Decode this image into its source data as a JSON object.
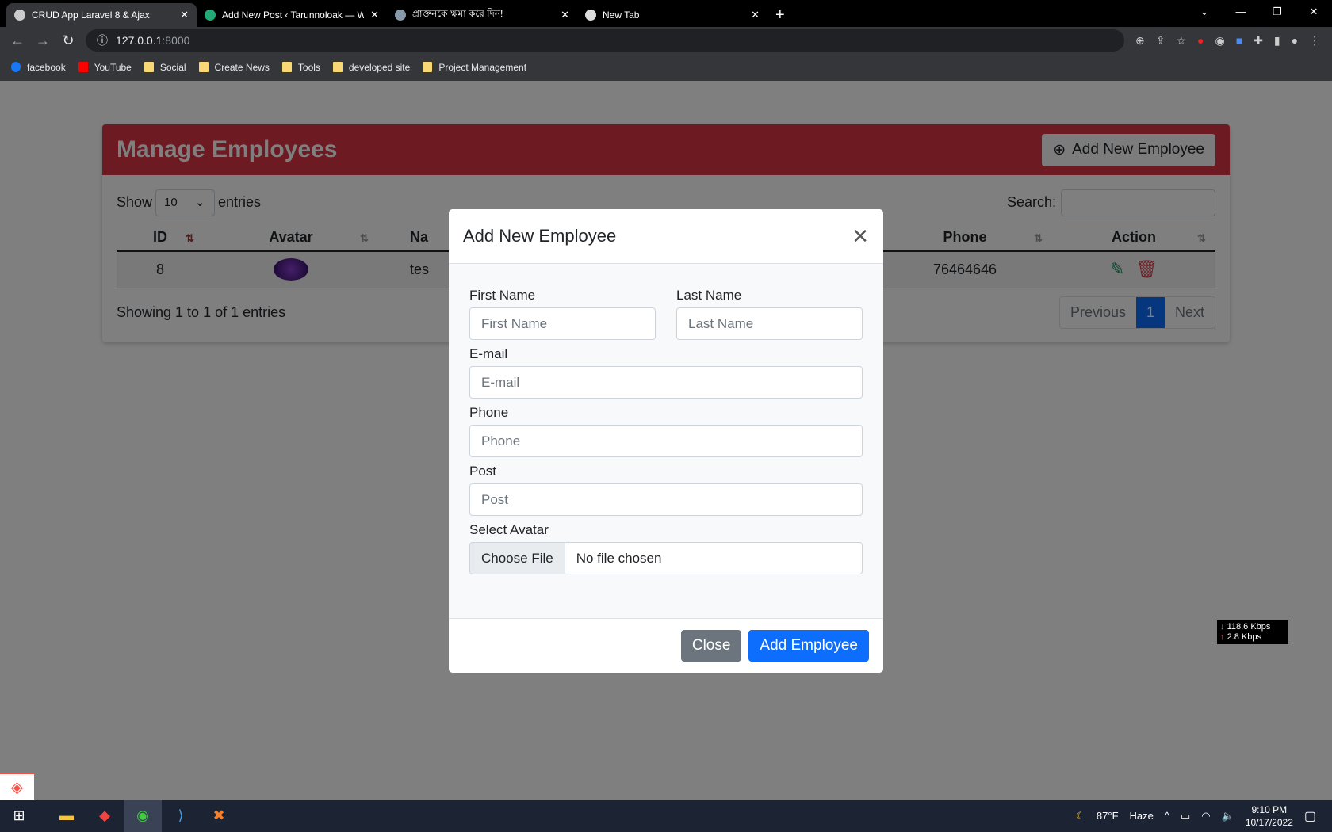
{
  "browser": {
    "tabs": [
      {
        "title": "CRUD App Laravel 8 & Ajax",
        "active": true
      },
      {
        "title": "Add New Post ‹ Tarunnoloak — W"
      },
      {
        "title": "প্রাক্তনকে ক্ষমা করে দিন!"
      },
      {
        "title": "New Tab"
      }
    ],
    "url_host": "127.0.0.1",
    "url_port": ":8000",
    "bookmarks": [
      "facebook",
      "YouTube",
      "Social",
      "Create News",
      "Tools",
      "developed site",
      "Project Management"
    ]
  },
  "card": {
    "title": "Manage Employees",
    "add_button": "Add New Employee",
    "show": "Show",
    "entries_value": "10",
    "entries": "entries",
    "search_label": "Search:",
    "columns": [
      "ID",
      "Avatar",
      "Na",
      "Phone",
      "Action"
    ],
    "rows": [
      {
        "id": "8",
        "name": "tes",
        "phone": "76464646"
      }
    ],
    "info": "Showing 1 to 1 of 1 entries",
    "prev": "Previous",
    "page": "1",
    "next": "Next",
    "header_color": "#dc3545"
  },
  "modal": {
    "title": "Add New Employee",
    "first_label": "First Name",
    "first_ph": "First Name",
    "last_label": "Last Name",
    "last_ph": "Last Name",
    "email_label": "E-mail",
    "email_ph": "E-mail",
    "phone_label": "Phone",
    "phone_ph": "Phone",
    "post_label": "Post",
    "post_ph": "Post",
    "avatar_label": "Select Avatar",
    "choose": "Choose File",
    "nofile": "No file chosen",
    "close": "Close",
    "submit": "Add Employee"
  },
  "net": {
    "down": "118.6 Kbps",
    "up": "2.8 Kbps"
  },
  "taskbar": {
    "weather": "87°F",
    "condition": "Haze",
    "time": "9:10 PM",
    "date": "10/17/2022"
  }
}
